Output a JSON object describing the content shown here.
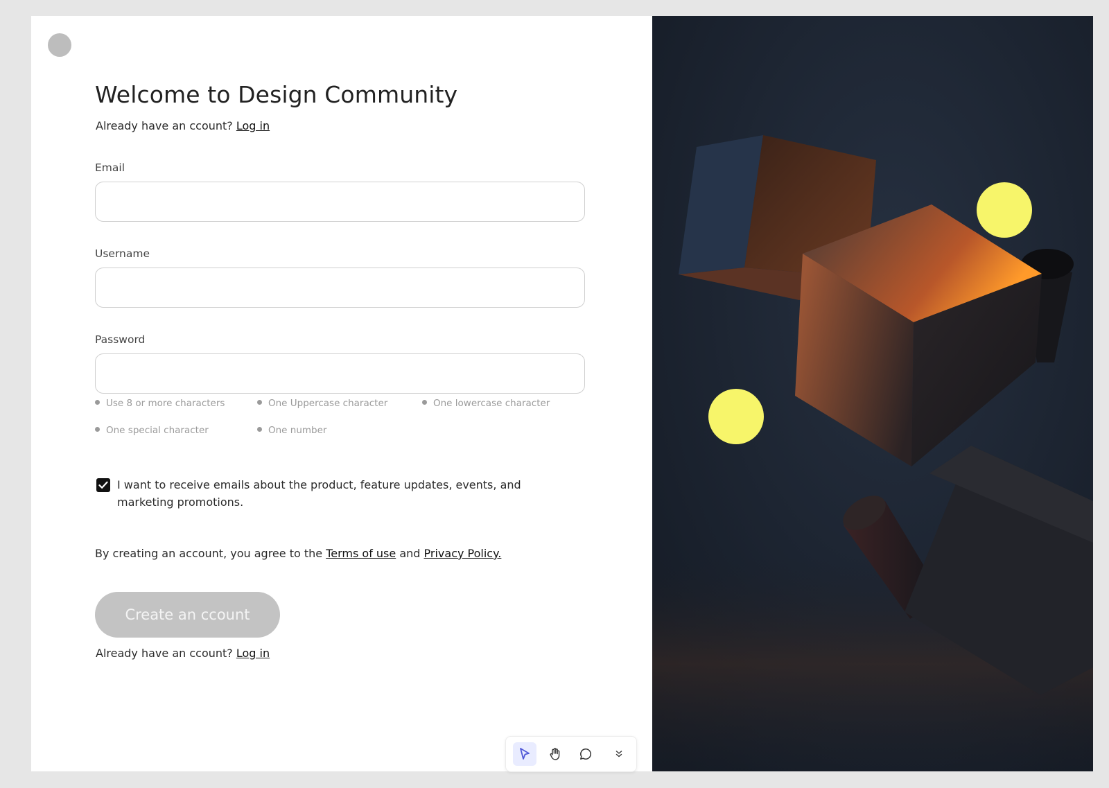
{
  "form": {
    "title": "Welcome to Design Community",
    "login_prompt": "Already have an ccount?",
    "login_link": "Log in",
    "email_label": "Email",
    "email_value": "",
    "username_label": "Username",
    "username_value": "",
    "password_label": "Password",
    "password_value": "",
    "password_rules": [
      "Use 8 or more characters",
      "One Uppercase character",
      "One lowercase character",
      "One special character",
      "One number"
    ],
    "marketing_checked": true,
    "marketing_label": "I want to receive emails about the product, feature updates, events, and marketing promotions.",
    "legal_prefix": "By creating an account, you agree to the",
    "terms_link": "Terms of use",
    "legal_and": "and",
    "privacy_link": "Privacy Policy.",
    "create_button": "Create an ccount",
    "bottom_login_prompt": "Already have an ccount?",
    "bottom_login_link": "Log in"
  },
  "toolbar": {
    "tools": [
      "pointer-icon",
      "hand-icon",
      "comment-icon",
      "chevron-double-down-icon"
    ],
    "active_tool": "pointer-icon"
  },
  "colors": {
    "hero_background": "#161d28",
    "button_disabled": "#c3c3c3",
    "sphere": "#f7f56a",
    "accent": "#5b63e8"
  }
}
